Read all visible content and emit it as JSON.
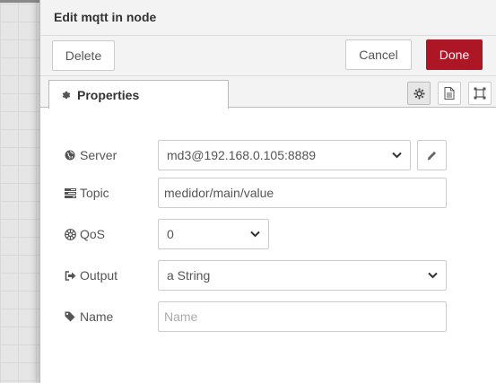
{
  "dialog": {
    "title": "Edit mqtt in node"
  },
  "toolbar": {
    "delete_label": "Delete",
    "cancel_label": "Cancel",
    "done_label": "Done"
  },
  "tabs": {
    "properties_label": "Properties",
    "icons": [
      "gear-icon",
      "file-text-icon",
      "appearance-icon"
    ]
  },
  "form": {
    "server": {
      "label": "Server",
      "value": "md3@192.168.0.105:8889",
      "icon": "globe-icon"
    },
    "topic": {
      "label": "Topic",
      "value": "medidor/main/value",
      "icon": "tasks-icon"
    },
    "qos": {
      "label": "QoS",
      "value": "0",
      "icon": "empire-icon"
    },
    "output": {
      "label": "Output",
      "value": "a String",
      "icon": "sign-out-icon"
    },
    "name": {
      "label": "Name",
      "value": "",
      "placeholder": "Name",
      "icon": "tag-icon"
    }
  },
  "colors": {
    "done_button": "#ad1625",
    "header_background": "#f3f3f3",
    "workspace_grid": "#e6e6e6"
  }
}
